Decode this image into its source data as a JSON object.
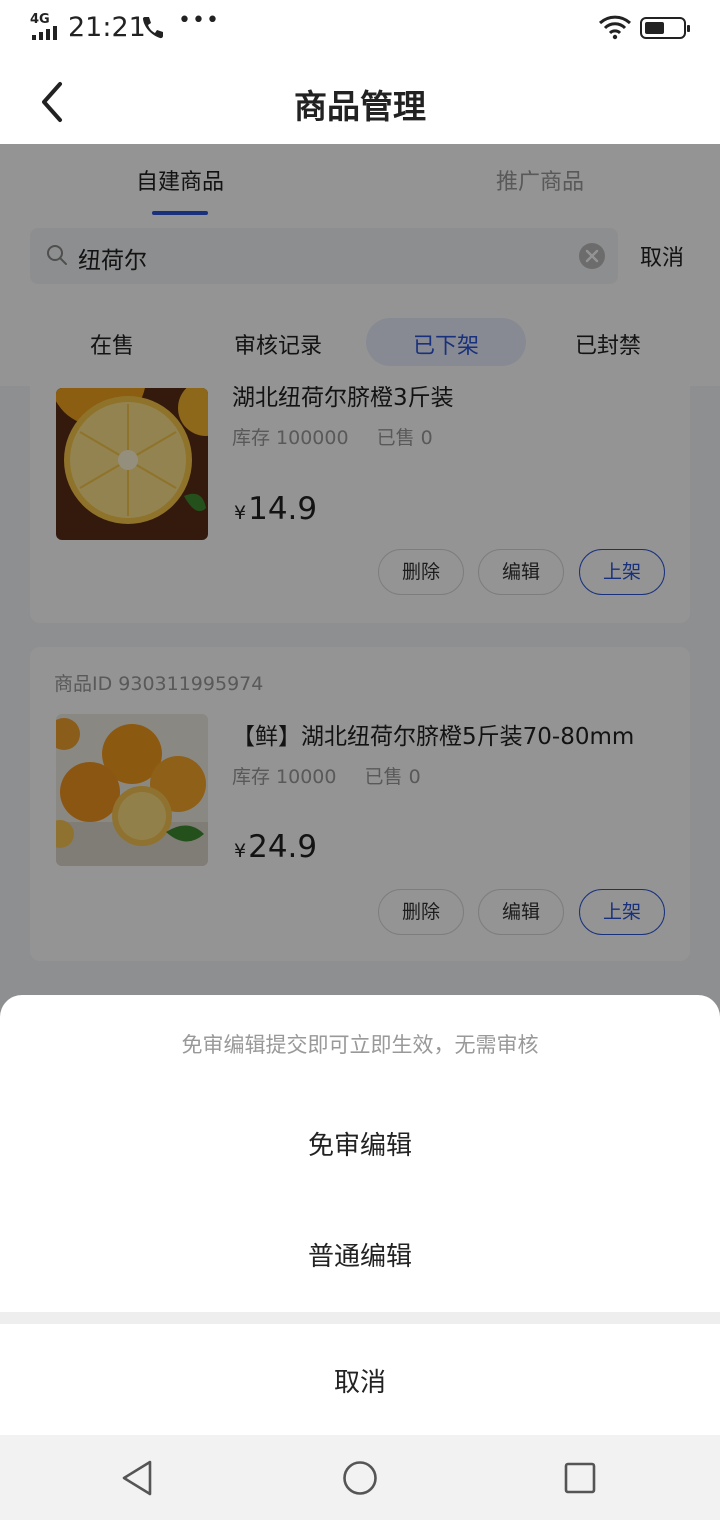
{
  "status_bar": {
    "network": "4G",
    "time": "21:21",
    "icons": [
      "signal-icon",
      "phone-icon",
      "more-dots-icon",
      "wifi-icon",
      "battery-icon"
    ],
    "battery_level": 0.45
  },
  "header": {
    "title": "商品管理",
    "back_icon": "back-arrow-icon"
  },
  "tabs": [
    {
      "label": "自建商品",
      "active": true
    },
    {
      "label": "推广商品",
      "active": false
    }
  ],
  "search": {
    "value": "纽荷尔",
    "cancel_label": "取消"
  },
  "filters": [
    {
      "label": "在售"
    },
    {
      "label": "审核记录"
    },
    {
      "label": "已下架",
      "active": true
    },
    {
      "label": "已封禁"
    }
  ],
  "products": [
    {
      "title": "湖北纽荷尔脐橙3斤装",
      "stock": "库存 100000",
      "sold": "已售 0",
      "currency": "¥",
      "price": "14.9",
      "actions": {
        "delete": "删除",
        "edit": "编辑",
        "list": "上架"
      }
    },
    {
      "id_text": "商品ID 930311995974",
      "title": "【鲜】湖北纽荷尔脐橙5斤装70-80mm",
      "stock": "库存 10000",
      "sold": "已售 0",
      "currency": "¥",
      "price": "24.9",
      "actions": {
        "delete": "删除",
        "edit": "编辑",
        "list": "上架"
      }
    }
  ],
  "action_sheet": {
    "hint": "免审编辑提交即可立即生效，无需审核",
    "options": [
      "免审编辑",
      "普通编辑"
    ],
    "cancel": "取消"
  },
  "system_nav": [
    "back-triangle-icon",
    "home-circle-icon",
    "recents-square-icon"
  ],
  "colors": {
    "accent": "#2c55d6",
    "overlay": "rgba(0,0,0,0.42)",
    "muted_text": "#999999"
  }
}
